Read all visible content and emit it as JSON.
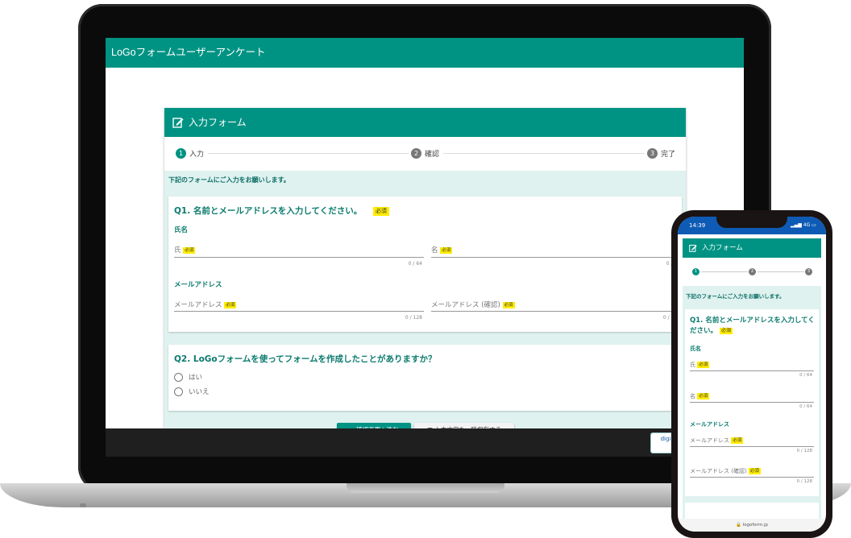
{
  "desktop": {
    "app_title": "LoGoフォームユーザーアンケート",
    "form_title": "入力フォーム",
    "steps": [
      {
        "num": "1",
        "label": "入力"
      },
      {
        "num": "2",
        "label": "確認"
      },
      {
        "num": "3",
        "label": "完了"
      }
    ],
    "notice": "下記のフォームにご入力をお願いします。",
    "required_badge": "必須",
    "q1": {
      "title": "Q1. 名前とメールアドレスを入力してください。",
      "name_section": "氏名",
      "last_name_label": "氏",
      "first_name_label": "名",
      "name_counter": "0 / 64",
      "email_section": "メールアドレス",
      "email_label": "メールアドレス",
      "email_confirm_label": "メールアドレス (確認)",
      "email_counter": "0 / 128"
    },
    "q2": {
      "title": "Q2. LoGoフォームを使ってフォームを作成したことがありますか？",
      "options": [
        "はい",
        "いいえ"
      ]
    },
    "next_button": "確認画面へ進む",
    "save_button": "入力内容を一時保存する",
    "footer_badge": "digi"
  },
  "mobile": {
    "time": "14:39",
    "signal": "4G",
    "form_title": "入力フォーム",
    "steps": [
      "1",
      "2",
      "3"
    ],
    "notice": "下記のフォームにご入力をお願いします。",
    "q1_title": "Q1. 名前とメールアドレスを入力してください。",
    "required_badge": "必須",
    "name_section": "氏名",
    "last_name_label": "氏",
    "first_name_label": "名",
    "name_counter": "0 / 64",
    "email_section": "メールアドレス",
    "email_label": "メールアドレス",
    "email_confirm_label": "メールアドレス (確認)",
    "email_counter": "0 / 128",
    "url": "logoform.jp"
  },
  "colors": {
    "primary": "#009383",
    "accent_bg": "#dff2f0",
    "required": "#ffec00"
  }
}
